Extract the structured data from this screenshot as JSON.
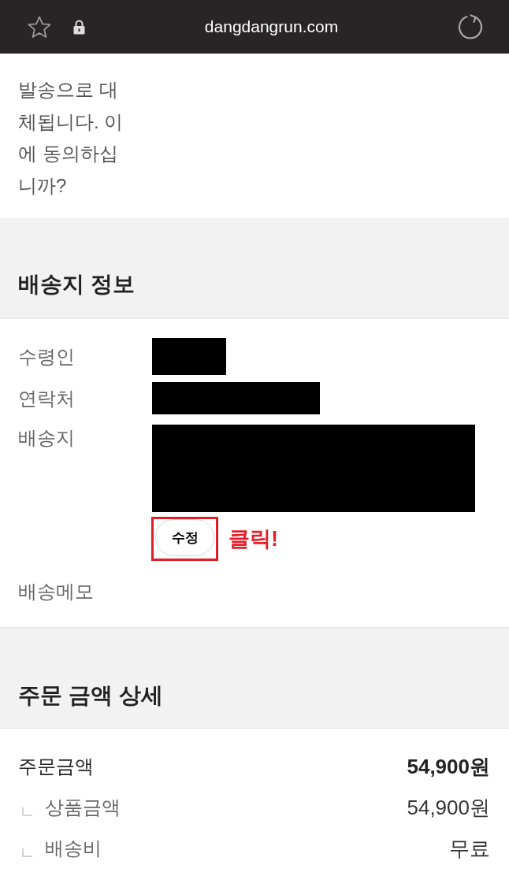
{
  "browser_bar": {
    "url": "dangdangrun.com"
  },
  "notice": {
    "text": "발송으로 대체됩니다. 이에 동의하십니까?"
  },
  "shipping": {
    "title": "배송지 정보",
    "fields": [
      {
        "label": "수령인",
        "redacted": true
      },
      {
        "label": "연락처",
        "redacted": true
      },
      {
        "label": "배송지",
        "redacted": true
      }
    ],
    "edit_button": {
      "label": "수정",
      "highlighted": true
    },
    "annotation": "클릭!",
    "memo": {
      "label": "배송메모"
    }
  },
  "order_amount": {
    "title": "주문 금액 상세",
    "rows": [
      {
        "kind": "total",
        "label": "주문금액",
        "value": "54,900원"
      },
      {
        "kind": "sub",
        "label": "상품금액",
        "value": "54,900원"
      },
      {
        "kind": "sub",
        "label": "배송비",
        "value": "무료"
      }
    ]
  }
}
